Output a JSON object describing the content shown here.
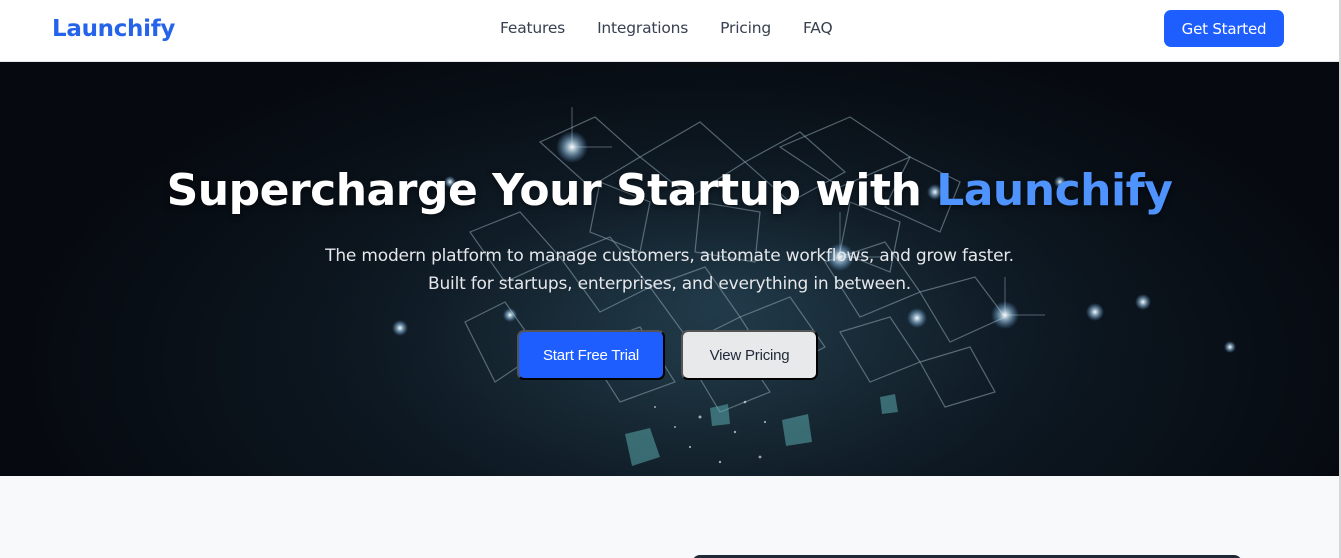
{
  "header": {
    "logo": "Launchify",
    "nav": [
      "Features",
      "Integrations",
      "Pricing",
      "FAQ"
    ],
    "cta_label": "Get Started"
  },
  "hero": {
    "title_main": "Supercharge Your Startup with",
    "title_accent": "Launchify",
    "subtitle_line1": "The modern platform to manage customers, automate workflows, and grow faster.",
    "subtitle_line2": "Built for startups, enterprises, and everything in between.",
    "primary_button": "Start Free Trial",
    "secondary_button": "View Pricing"
  },
  "colors": {
    "brand": "#2563eb",
    "button_primary": "#1e5eff",
    "accent_text": "#4f93ff",
    "hero_bg": "#06090f",
    "section_bg": "#f8f9fb"
  }
}
